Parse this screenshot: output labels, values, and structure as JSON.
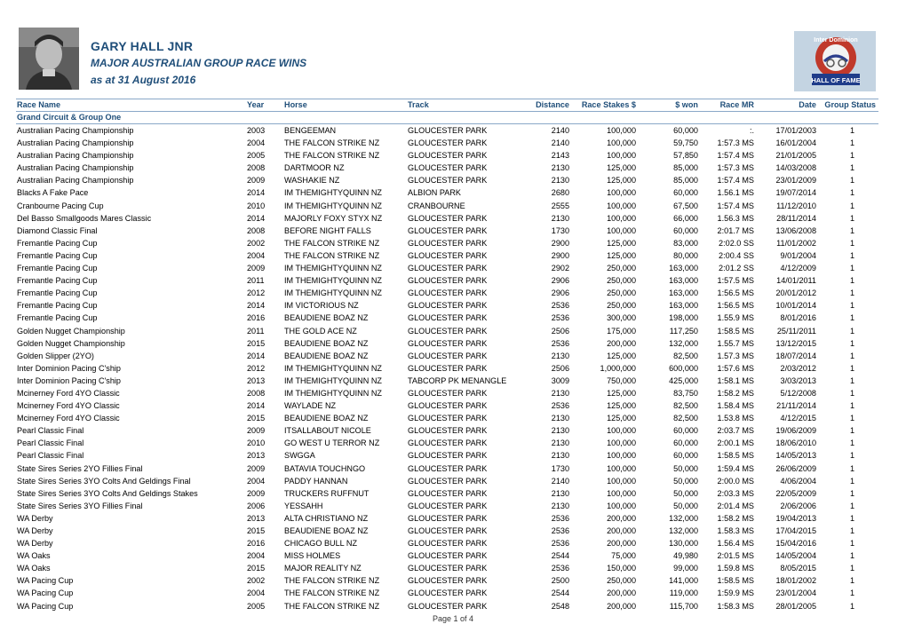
{
  "header": {
    "title": "GARY HALL JNR",
    "subtitle": "MAJOR AUSTRALIAN GROUP RACE WINS",
    "date_line": "as at 31 August 2016",
    "logo_top_text": "Inter Dominion",
    "logo_bottom_text": "HALL OF FAME"
  },
  "columns": {
    "race_name": "Race Name",
    "year": "Year",
    "horse": "Horse",
    "track": "Track",
    "distance": "Distance",
    "race_stakes": "Race Stakes $",
    "won": "$ won",
    "race_mr": "Race MR",
    "date": "Date",
    "group_status": "Group Status"
  },
  "group_heading": "Grand Circuit & Group One",
  "rows": [
    [
      "Australian Pacing Championship",
      "2003",
      "BENGEEMAN",
      "GLOUCESTER PARK",
      "2140",
      "100,000",
      "60,000",
      ":.",
      "17/01/2003",
      "1"
    ],
    [
      "Australian Pacing Championship",
      "2004",
      "THE FALCON STRIKE NZ",
      "GLOUCESTER PARK",
      "2140",
      "100,000",
      "59,750",
      "1:57.3 MS",
      "16/01/2004",
      "1"
    ],
    [
      "Australian Pacing Championship",
      "2005",
      "THE FALCON STRIKE NZ",
      "GLOUCESTER PARK",
      "2143",
      "100,000",
      "57,850",
      "1:57.4 MS",
      "21/01/2005",
      "1"
    ],
    [
      "Australian Pacing Championship",
      "2008",
      "DARTMOOR NZ",
      "GLOUCESTER PARK",
      "2130",
      "125,000",
      "85,000",
      "1:57.3 MS",
      "14/03/2008",
      "1"
    ],
    [
      "Australian Pacing Championship",
      "2009",
      "WASHAKIE NZ",
      "GLOUCESTER PARK",
      "2130",
      "125,000",
      "85,000",
      "1:57.4 MS",
      "23/01/2009",
      "1"
    ],
    [
      "Blacks A Fake Pace",
      "2014",
      "IM THEMIGHTYQUINN NZ",
      "ALBION PARK",
      "2680",
      "100,000",
      "60,000",
      "1.56.1 MS",
      "19/07/2014",
      "1"
    ],
    [
      "Cranbourne Pacing Cup",
      "2010",
      "IM THEMIGHTYQUINN NZ",
      "CRANBOURNE",
      "2555",
      "100,000",
      "67,500",
      "1:57.4 MS",
      "11/12/2010",
      "1"
    ],
    [
      "Del Basso Smallgoods Mares Classic",
      "2014",
      "MAJORLY FOXY STYX NZ",
      "GLOUCESTER PARK",
      "2130",
      "100,000",
      "66,000",
      "1.56.3 MS",
      "28/11/2014",
      "1"
    ],
    [
      "Diamond Classic Final",
      "2008",
      "BEFORE NIGHT FALLS",
      "GLOUCESTER PARK",
      "1730",
      "100,000",
      "60,000",
      "2:01.7 MS",
      "13/06/2008",
      "1"
    ],
    [
      "Fremantle Pacing Cup",
      "2002",
      "THE FALCON STRIKE NZ",
      "GLOUCESTER PARK",
      "2900",
      "125,000",
      "83,000",
      "2:02.0 SS",
      "11/01/2002",
      "1"
    ],
    [
      "Fremantle Pacing Cup",
      "2004",
      "THE FALCON STRIKE NZ",
      "GLOUCESTER PARK",
      "2900",
      "125,000",
      "80,000",
      "2:00.4 SS",
      "9/01/2004",
      "1"
    ],
    [
      "Fremantle Pacing Cup",
      "2009",
      "IM THEMIGHTYQUINN NZ",
      "GLOUCESTER PARK",
      "2902",
      "250,000",
      "163,000",
      "2:01.2 SS",
      "4/12/2009",
      "1"
    ],
    [
      "Fremantle Pacing Cup",
      "2011",
      "IM THEMIGHTYQUINN NZ",
      "GLOUCESTER PARK",
      "2906",
      "250,000",
      "163,000",
      "1:57.5 MS",
      "14/01/2011",
      "1"
    ],
    [
      "Fremantle Pacing Cup",
      "2012",
      "IM THEMIGHTYQUINN NZ",
      "GLOUCESTER PARK",
      "2906",
      "250,000",
      "163,000",
      "1:56.5 MS",
      "20/01/2012",
      "1"
    ],
    [
      "Fremantle Pacing Cup",
      "2014",
      "IM VICTORIOUS NZ",
      "GLOUCESTER PARK",
      "2536",
      "250,000",
      "163,000",
      "1:56.5 MS",
      "10/01/2014",
      "1"
    ],
    [
      "Fremantle Pacing Cup",
      "2016",
      "BEAUDIENE BOAZ NZ",
      "GLOUCESTER PARK",
      "2536",
      "300,000",
      "198,000",
      "1.55.9 MS",
      "8/01/2016",
      "1"
    ],
    [
      "Golden Nugget Championship",
      "2011",
      "THE GOLD ACE NZ",
      "GLOUCESTER PARK",
      "2506",
      "175,000",
      "117,250",
      "1:58.5 MS",
      "25/11/2011",
      "1"
    ],
    [
      "Golden Nugget Championship",
      "2015",
      "BEAUDIENE BOAZ NZ",
      "GLOUCESTER PARK",
      "2536",
      "200,000",
      "132,000",
      "1.55.7 MS",
      "13/12/2015",
      "1"
    ],
    [
      "Golden Slipper (2YO)",
      "2014",
      "BEAUDIENE BOAZ NZ",
      "GLOUCESTER PARK",
      "2130",
      "125,000",
      "82,500",
      "1.57.3 MS",
      "18/07/2014",
      "1"
    ],
    [
      "Inter Dominion Pacing C'ship",
      "2012",
      "IM THEMIGHTYQUINN NZ",
      "GLOUCESTER PARK",
      "2506",
      "1,000,000",
      "600,000",
      "1:57.6 MS",
      "2/03/2012",
      "1"
    ],
    [
      "Inter Dominion Pacing C'ship",
      "2013",
      "IM THEMIGHTYQUINN NZ",
      "TABCORP PK MENANGLE",
      "3009",
      "750,000",
      "425,000",
      "1:58.1 MS",
      "3/03/2013",
      "1"
    ],
    [
      "Mcinerney Ford 4YO Classic",
      "2008",
      "IM THEMIGHTYQUINN NZ",
      "GLOUCESTER PARK",
      "2130",
      "125,000",
      "83,750",
      "1:58.2 MS",
      "5/12/2008",
      "1"
    ],
    [
      "Mcinerney Ford 4YO Classic",
      "2014",
      "WAYLADE NZ",
      "GLOUCESTER PARK",
      "2536",
      "125,000",
      "82,500",
      "1.58.4 MS",
      "21/11/2014",
      "1"
    ],
    [
      "Mcinerney Ford 4YO Classic",
      "2015",
      "BEAUDIENE BOAZ NZ",
      "GLOUCESTER PARK",
      "2130",
      "125,000",
      "82,500",
      "1.53.8 MS",
      "4/12/2015",
      "1"
    ],
    [
      "Pearl Classic Final",
      "2009",
      "ITSALLABOUT NICOLE",
      "GLOUCESTER PARK",
      "2130",
      "100,000",
      "60,000",
      "2:03.7 MS",
      "19/06/2009",
      "1"
    ],
    [
      "Pearl Classic Final",
      "2010",
      "GO WEST U TERROR NZ",
      "GLOUCESTER PARK",
      "2130",
      "100,000",
      "60,000",
      "2:00.1 MS",
      "18/06/2010",
      "1"
    ],
    [
      "Pearl Classic Final",
      "2013",
      "SWGGA",
      "GLOUCESTER PARK",
      "2130",
      "100,000",
      "60,000",
      "1:58.5 MS",
      "14/05/2013",
      "1"
    ],
    [
      "State Sires Series 2YO Fillies Final",
      "2009",
      "BATAVIA TOUCHNGO",
      "GLOUCESTER PARK",
      "1730",
      "100,000",
      "50,000",
      "1:59.4 MS",
      "26/06/2009",
      "1"
    ],
    [
      "State Sires Series 3YO Colts And Geldings Final",
      "2004",
      "PADDY HANNAN",
      "GLOUCESTER PARK",
      "2140",
      "100,000",
      "50,000",
      "2:00.0 MS",
      "4/06/2004",
      "1"
    ],
    [
      "State Sires Series 3YO Colts And Geldings Stakes",
      "2009",
      "TRUCKERS RUFFNUT",
      "GLOUCESTER PARK",
      "2130",
      "100,000",
      "50,000",
      "2:03.3 MS",
      "22/05/2009",
      "1"
    ],
    [
      "State Sires Series 3YO Fillies Final",
      "2006",
      "YESSAHH",
      "GLOUCESTER PARK",
      "2130",
      "100,000",
      "50,000",
      "2:01.4 MS",
      "2/06/2006",
      "1"
    ],
    [
      "WA Derby",
      "2013",
      "ALTA CHRISTIANO NZ",
      "GLOUCESTER PARK",
      "2536",
      "200,000",
      "132,000",
      "1:58.2 MS",
      "19/04/2013",
      "1"
    ],
    [
      "WA Derby",
      "2015",
      "BEAUDIENE BOAZ NZ",
      "GLOUCESTER PARK",
      "2536",
      "200,000",
      "132,000",
      "1.58.3 MS",
      "17/04/2015",
      "1"
    ],
    [
      "WA Derby",
      "2016",
      "CHICAGO BULL NZ",
      "GLOUCESTER PARK",
      "2536",
      "200,000",
      "130,000",
      "1.56.4 MS",
      "15/04/2016",
      "1"
    ],
    [
      "WA Oaks",
      "2004",
      "MISS HOLMES",
      "GLOUCESTER PARK",
      "2544",
      "75,000",
      "49,980",
      "2:01.5 MS",
      "14/05/2004",
      "1"
    ],
    [
      "WA Oaks",
      "2015",
      "MAJOR REALITY NZ",
      "GLOUCESTER PARK",
      "2536",
      "150,000",
      "99,000",
      "1.59.8 MS",
      "8/05/2015",
      "1"
    ],
    [
      "WA Pacing Cup",
      "2002",
      "THE FALCON STRIKE NZ",
      "GLOUCESTER PARK",
      "2500",
      "250,000",
      "141,000",
      "1:58.5 MS",
      "18/01/2002",
      "1"
    ],
    [
      "WA Pacing Cup",
      "2004",
      "THE FALCON STRIKE NZ",
      "GLOUCESTER PARK",
      "2544",
      "200,000",
      "119,000",
      "1:59.9 MS",
      "23/01/2004",
      "1"
    ],
    [
      "WA Pacing Cup",
      "2005",
      "THE FALCON STRIKE NZ",
      "GLOUCESTER PARK",
      "2548",
      "200,000",
      "115,700",
      "1:58.3 MS",
      "28/01/2005",
      "1"
    ]
  ],
  "footer": "Page 1 of 4"
}
